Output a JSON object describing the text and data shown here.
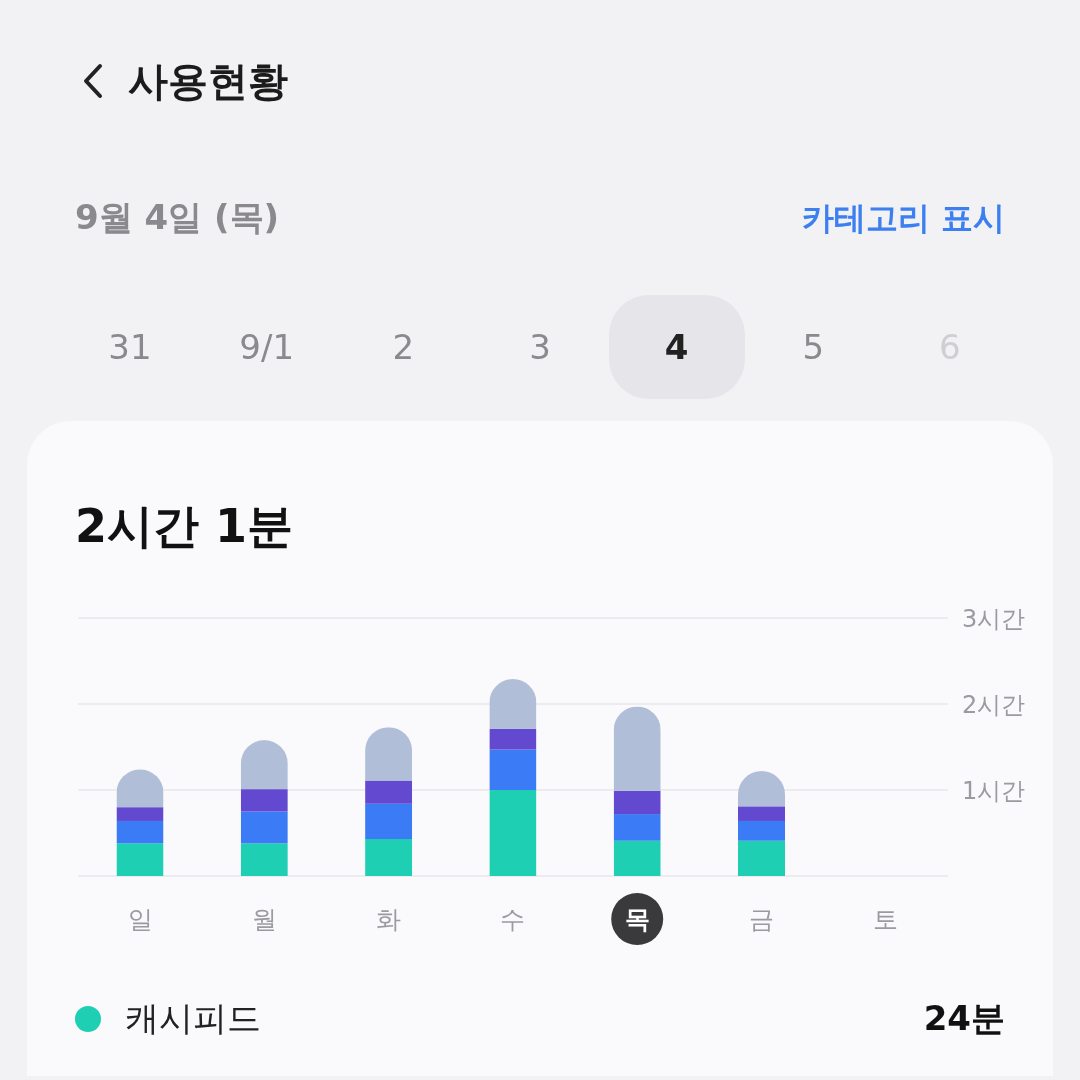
{
  "header": {
    "title": "사용현황"
  },
  "summary": {
    "date": "9월 4일 (목)",
    "category_link": "카테고리 표시"
  },
  "date_tabs": [
    {
      "label": "31",
      "selected": false,
      "disabled": false
    },
    {
      "label": "9/1",
      "selected": false,
      "disabled": false
    },
    {
      "label": "2",
      "selected": false,
      "disabled": false
    },
    {
      "label": "3",
      "selected": false,
      "disabled": false
    },
    {
      "label": "4",
      "selected": true,
      "disabled": false
    },
    {
      "label": "5",
      "selected": false,
      "disabled": false
    },
    {
      "label": "6",
      "selected": false,
      "disabled": true
    }
  ],
  "card": {
    "total": "2시간 1분",
    "chart_data": {
      "type": "bar",
      "stacked": true,
      "categories": [
        "일",
        "월",
        "화",
        "수",
        "목",
        "금",
        "토"
      ],
      "ylim": [
        0,
        3
      ],
      "yticks": [
        {
          "value": 1,
          "label": "1시간"
        },
        {
          "value": 2,
          "label": "2시간"
        },
        {
          "value": 3,
          "label": "3시간"
        }
      ],
      "series": [
        {
          "color": "#1ecfb4",
          "values": [
            0.38,
            0.38,
            0.43,
            1.0,
            0.41,
            0.41,
            null
          ]
        },
        {
          "color": "#3b7bf6",
          "values": [
            0.26,
            0.37,
            0.41,
            0.47,
            0.31,
            0.23,
            null
          ]
        },
        {
          "color": "#6349cf",
          "values": [
            0.16,
            0.26,
            0.27,
            0.24,
            0.27,
            0.17,
            null
          ]
        },
        {
          "color": "#b1bed8",
          "values": [
            0.44,
            0.57,
            0.62,
            0.58,
            0.98,
            0.41,
            null
          ]
        }
      ]
    },
    "days": [
      {
        "selected": false
      },
      {
        "selected": false
      },
      {
        "selected": false
      },
      {
        "selected": false
      },
      {
        "selected": true
      },
      {
        "selected": false
      },
      {
        "selected": false
      }
    ],
    "legend": [
      {
        "name": "캐시피드",
        "color": "#1ecfb4",
        "duration": "24분"
      }
    ]
  }
}
